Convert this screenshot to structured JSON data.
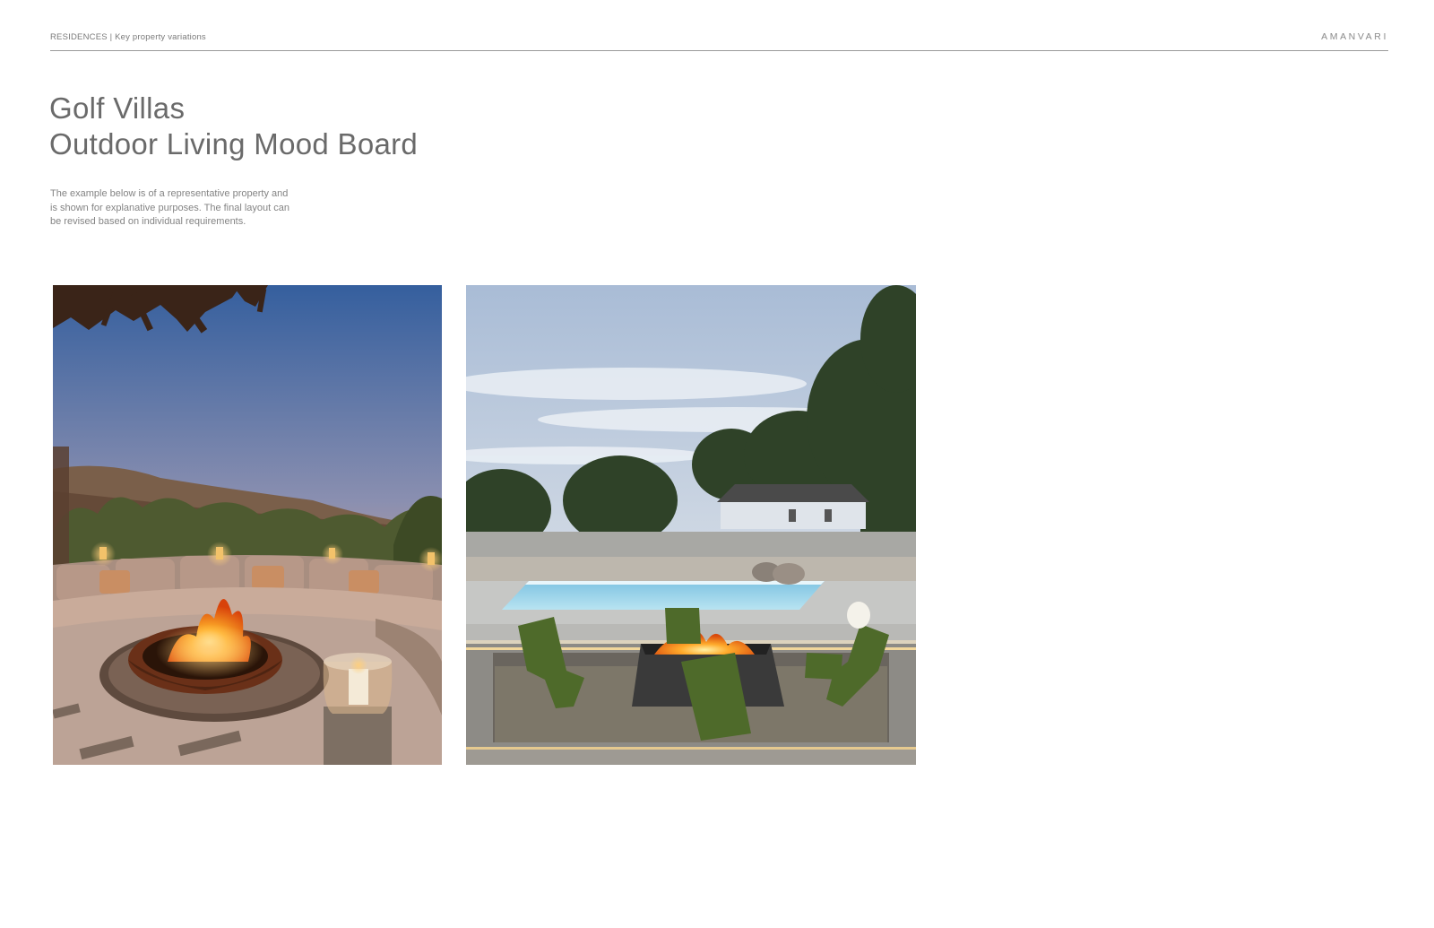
{
  "header": {
    "section": "RESIDENCES",
    "separator": "|",
    "subtitle": "Key property variations",
    "brand": "AMANVARI"
  },
  "title": {
    "line1": "Golf Villas",
    "line2": "Outdoor Living Mood Board"
  },
  "description": {
    "line1": "The example below is of a representative property and",
    "line2": "is shown for explanative purposes. The final layout can",
    "line3": "be revised based on individual requirements."
  },
  "images": [
    {
      "name": "desert-sunset-firepit-lounge",
      "colors": {
        "sky_top": "#3d6aa8",
        "sky_bottom": "#f2b08a",
        "fire": "#ff9a1e"
      }
    },
    {
      "name": "pool-sunken-firepit-patio",
      "colors": {
        "sky": "#c6d3e3",
        "pool": "#8fd0e8",
        "chairs": "#4f6a2a"
      }
    }
  ]
}
